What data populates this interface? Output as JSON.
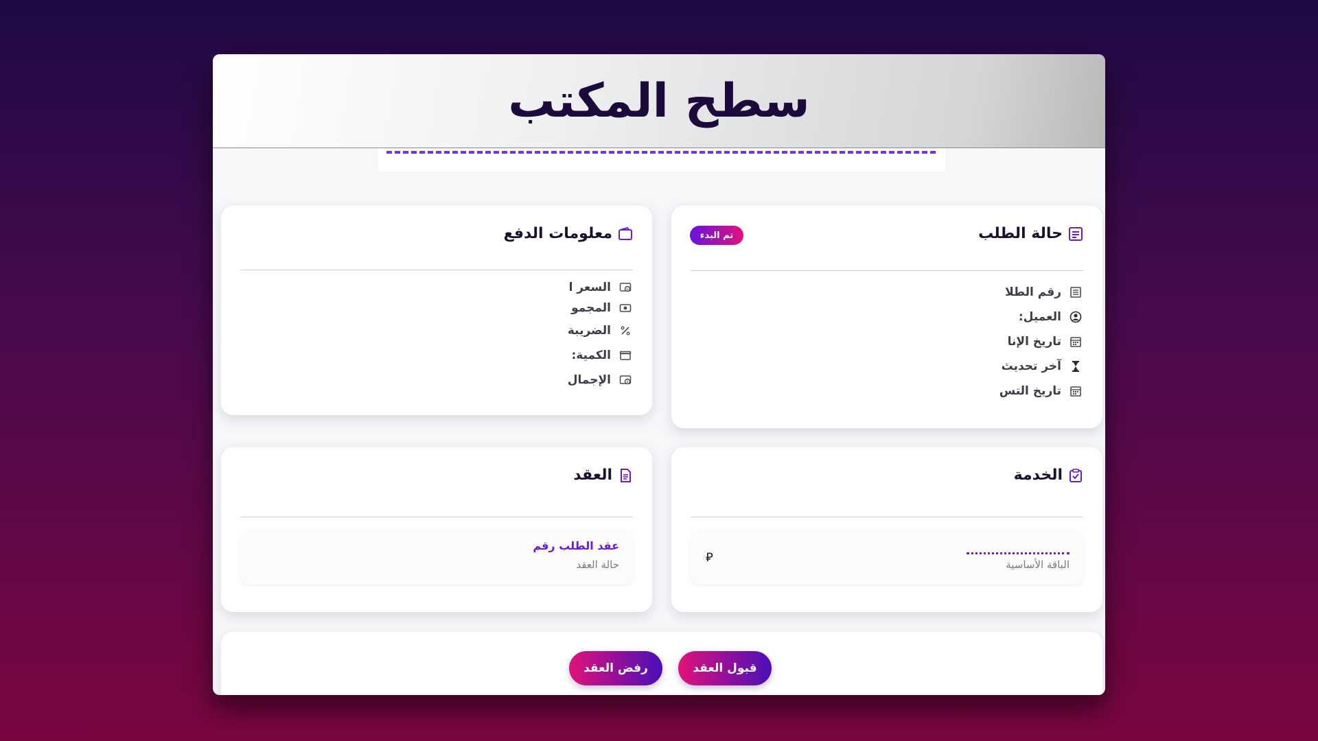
{
  "header": {
    "title": "سطح المكتب"
  },
  "order_status": {
    "title": "حالة الطلب",
    "badge": "تم البدء",
    "rows": [
      {
        "icon": "document-icon",
        "label": "رقم الطلا"
      },
      {
        "icon": "user-circle-icon",
        "label": "العميل:"
      },
      {
        "icon": "calendar-icon",
        "label": "تاريخ الإنا"
      },
      {
        "icon": "hourglass-icon",
        "label": "آخر تحديث"
      },
      {
        "icon": "calendar-icon",
        "label": "تاريخ التس"
      }
    ]
  },
  "payment": {
    "title": "معلومات الدفع",
    "rows": [
      {
        "icon": "price-tag-icon",
        "label": "السعر ا"
      },
      {
        "icon": "money-icon",
        "label": "المجمو"
      },
      {
        "icon": "percent-icon",
        "label": "الضريبة"
      },
      {
        "icon": "box-icon",
        "label": "الكمية:"
      },
      {
        "icon": "price-tag-icon",
        "label": "الإجمال"
      }
    ]
  },
  "service": {
    "title": "الخدمة",
    "package_label": "الباقة الأساسية",
    "currency": "⃁"
  },
  "contract": {
    "title": "العقد",
    "contract_link": "عقد الطلب رقم",
    "status_label": "حالة العقد"
  },
  "actions": {
    "accept_label": "قبول العقد",
    "reject_label": "رفض العقد"
  },
  "colors": {
    "accent_purple": "#6a1bd6",
    "accent_pink": "#e0127a",
    "dark_navy": "#1c0a3c"
  }
}
